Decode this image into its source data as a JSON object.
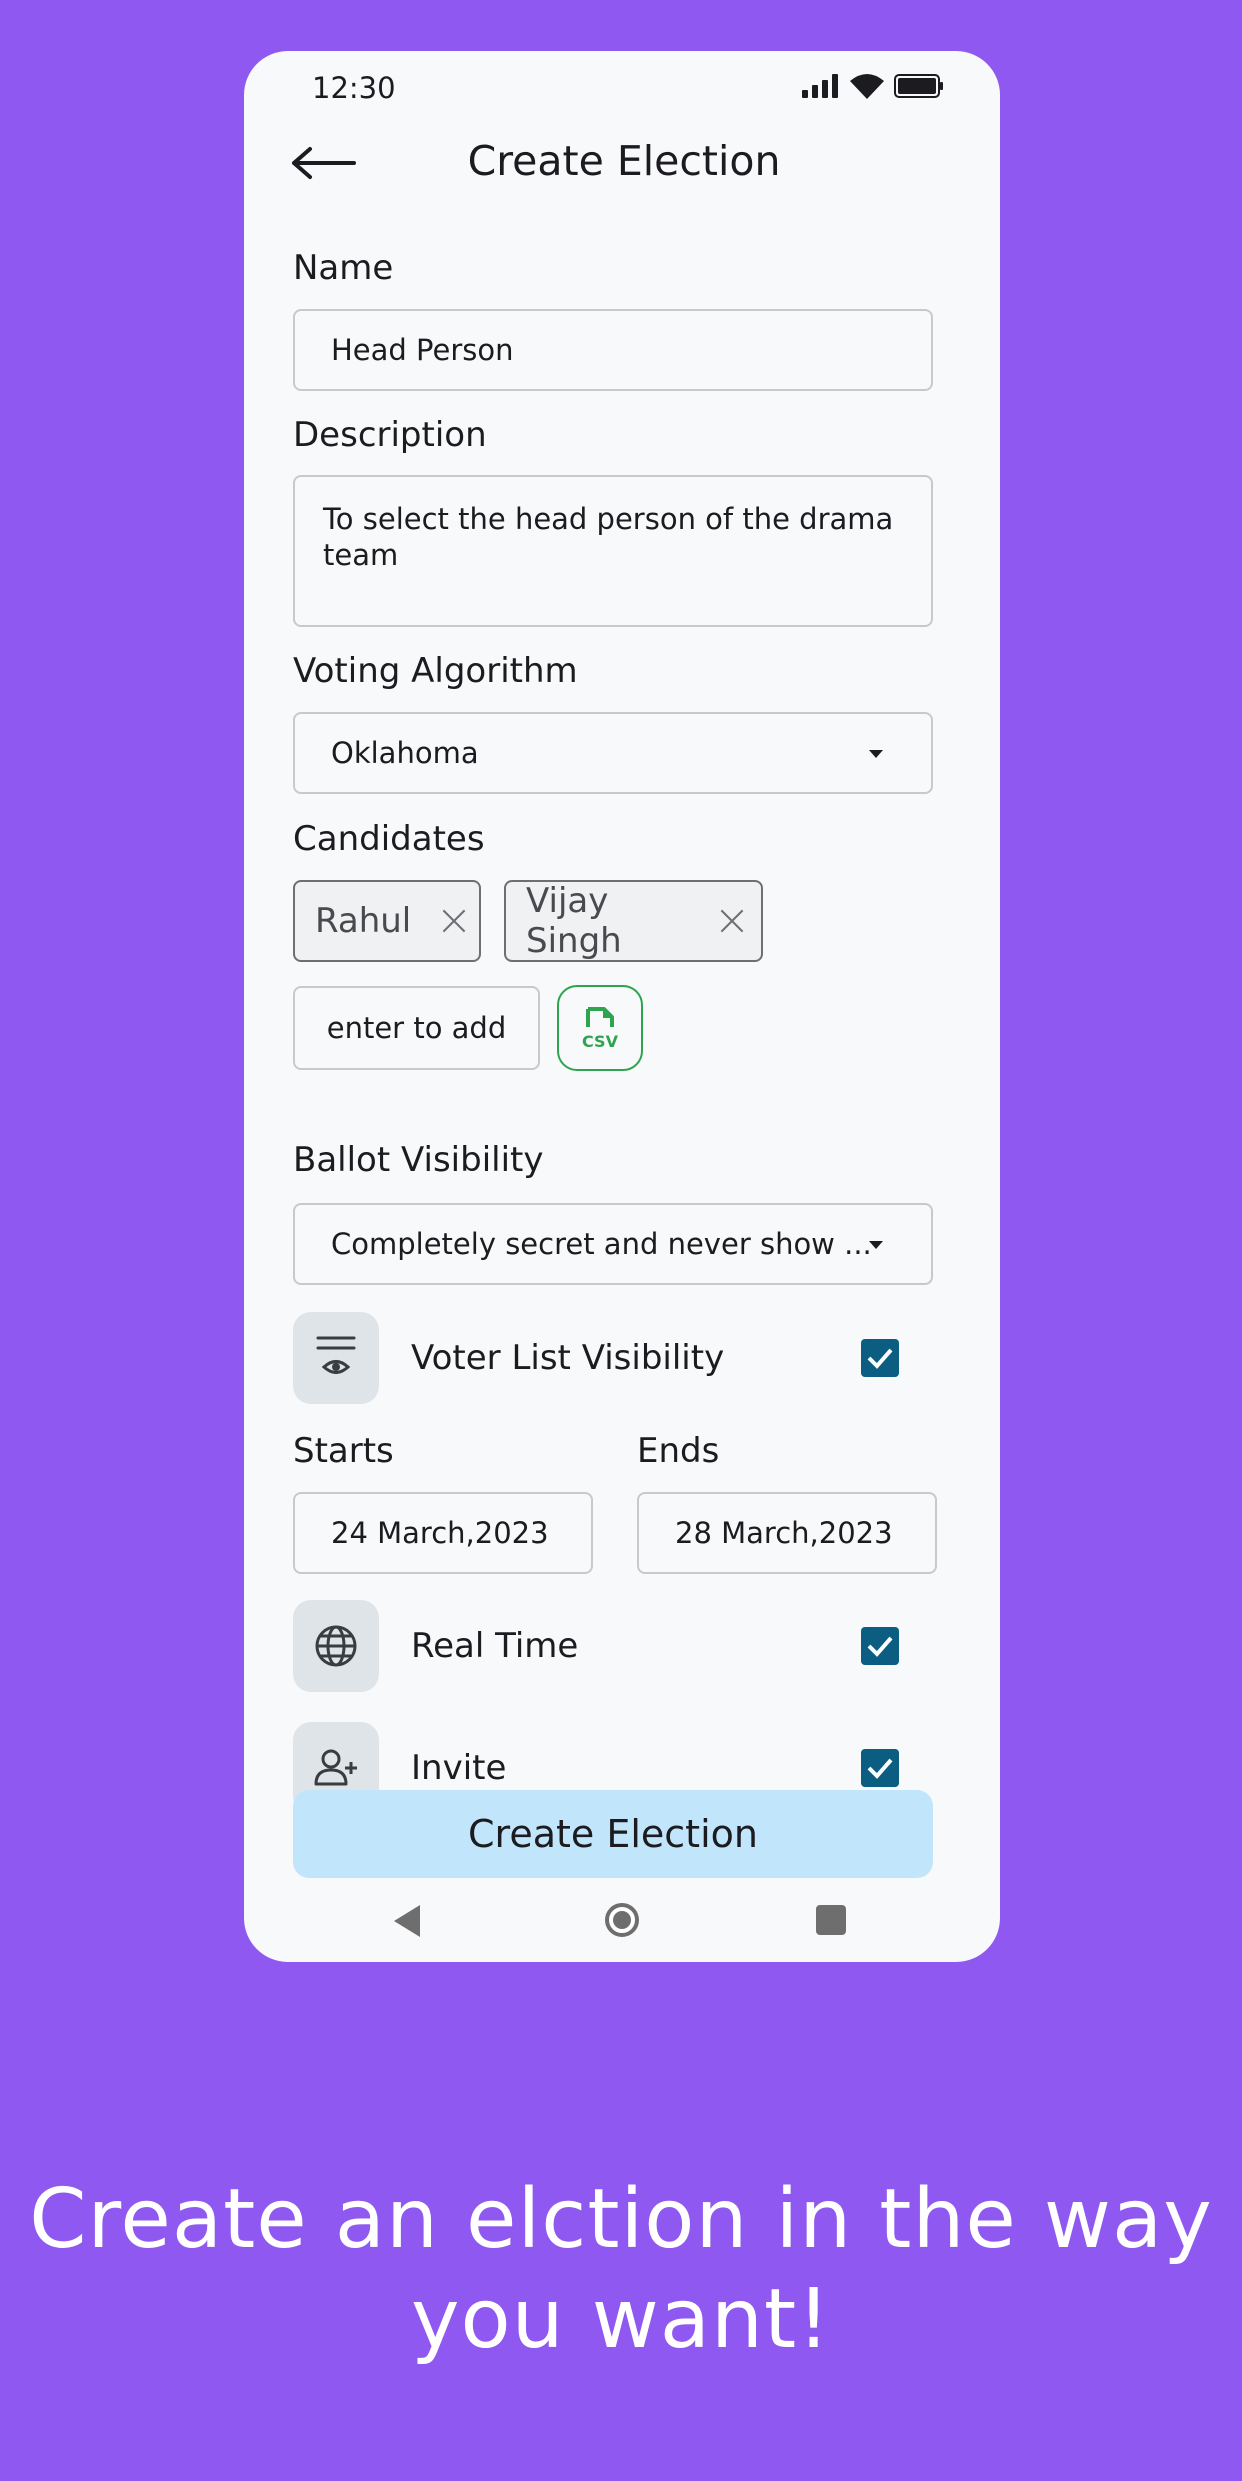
{
  "status_bar": {
    "time": "12:30"
  },
  "header": {
    "title": "Create Election"
  },
  "form": {
    "name_label": "Name",
    "name_value": "Head Person",
    "description_label": "Description",
    "description_value": "To select the head person of the drama team",
    "algorithm_label": "Voting Algorithm",
    "algorithm_value": "Oklahoma",
    "candidates_label": "Candidates",
    "candidates": [
      {
        "name": "Rahul"
      },
      {
        "name": "Vijay Singh"
      }
    ],
    "candidate_input_placeholder": "enter to add",
    "csv_label": "CSV",
    "ballot_label": "Ballot Visibility",
    "ballot_value": "Completely secret and never show ...",
    "voter_list_label": "Voter List Visibility",
    "voter_list_checked": true,
    "starts_label": "Starts",
    "starts_value": "24 March,2023",
    "ends_label": "Ends",
    "ends_value": "28 March,2023",
    "realtime_label": "Real Time",
    "realtime_checked": true,
    "invite_label": "Invite",
    "invite_checked": true,
    "submit_label": "Create Election"
  },
  "icons": {
    "back": "arrow-left-icon",
    "voter_list": "list-eye-icon",
    "realtime": "globe-icon",
    "invite": "person-add-icon",
    "csv": "csv-file-icon"
  },
  "colors": {
    "background": "#8f58f0",
    "checkbox": "#0b5e82",
    "submit_button": "#c1e6fb",
    "csv_accent": "#2ea44f"
  },
  "caption": {
    "line1": "Create an elction in the way",
    "line2": "you want!"
  }
}
